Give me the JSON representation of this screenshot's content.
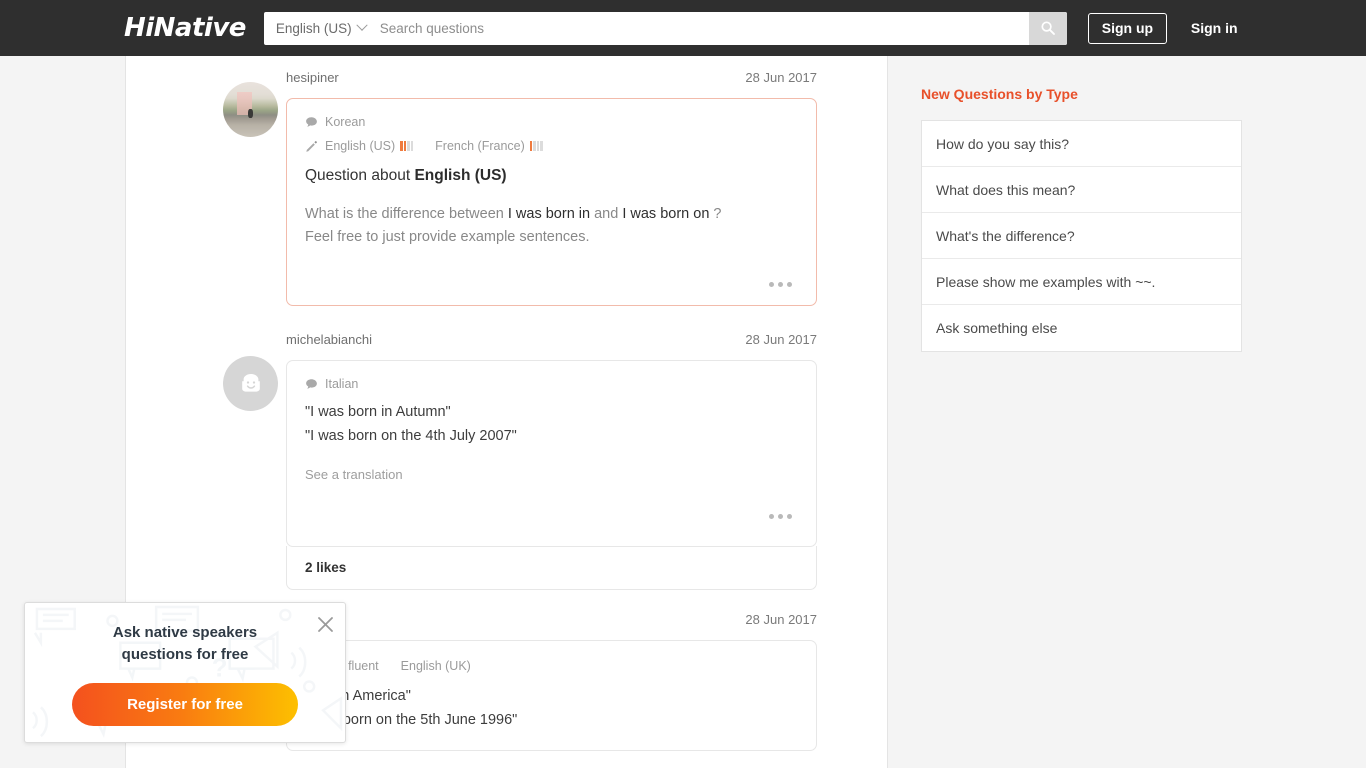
{
  "header": {
    "logo": "HiNative",
    "language_selector": "English (US)",
    "search_placeholder": "Search questions",
    "search_value": "",
    "search_icon": "search-icon",
    "signup_label": "Sign up",
    "signin_label": "Sign in"
  },
  "posts": [
    {
      "kind": "question",
      "username": "hesipiner",
      "date": "28 Jun 2017",
      "avatar": "photo",
      "speaks_icon": "speech-bubble-icon",
      "speaks": "Korean",
      "learning_icon": "pencil-icon",
      "learning": [
        {
          "name": "English (US)",
          "level": 2,
          "max": 4
        },
        {
          "name": "French (France)",
          "level": 1,
          "max": 4
        }
      ],
      "title_prefix": "Question about ",
      "title_lang": "English (US)",
      "body_1": "What is the difference between ",
      "body_hl_1": "I was born in",
      "body_2": " and ",
      "body_hl_2": "I was born on",
      "body_3": " ?",
      "body_4": "Feel free to just provide example sentences.",
      "menu_icon": "ellipsis-icon"
    },
    {
      "kind": "answer",
      "username": "michelabianchi",
      "date": "28 Jun 2017",
      "avatar": "default",
      "speaks_icon": "speech-bubble-icon",
      "speaks": "Italian",
      "answer_line_1": "\"I was born in Autumn\"",
      "answer_line_2": "\"I was born on the 4th July 2007\"",
      "translate_label": "See a translation",
      "menu_icon": "ellipsis-icon",
      "likes_label": "2 likes"
    },
    {
      "kind": "answer",
      "username": "",
      "date": "28 Jun 2017",
      "avatar": "hidden",
      "learning_partial": "ic Near fluent",
      "learning_second": "English (UK)",
      "answer_line_1": "born in America\"",
      "answer_line_2": "I was born on the 5th June 1996\""
    }
  ],
  "sidebar": {
    "title": "New Questions by Type",
    "items": [
      {
        "label": "How do you say this?"
      },
      {
        "label": "What does this mean?"
      },
      {
        "label": "What's the difference?"
      },
      {
        "label": "Please show me examples with ~~."
      },
      {
        "label": "Ask something else"
      }
    ]
  },
  "promo": {
    "title_line_1": "Ask native speakers",
    "title_line_2": "questions for free",
    "button_label": "Register for free",
    "close_icon": "close-icon"
  },
  "colors": {
    "accent_orange": "#e8502a",
    "header_bg": "#2f2f2f",
    "question_border": "#f2bbab",
    "proficiency_on": "#ef7b3f",
    "promo_gradient_start": "#f4511e",
    "promo_gradient_end": "#fdc000"
  }
}
